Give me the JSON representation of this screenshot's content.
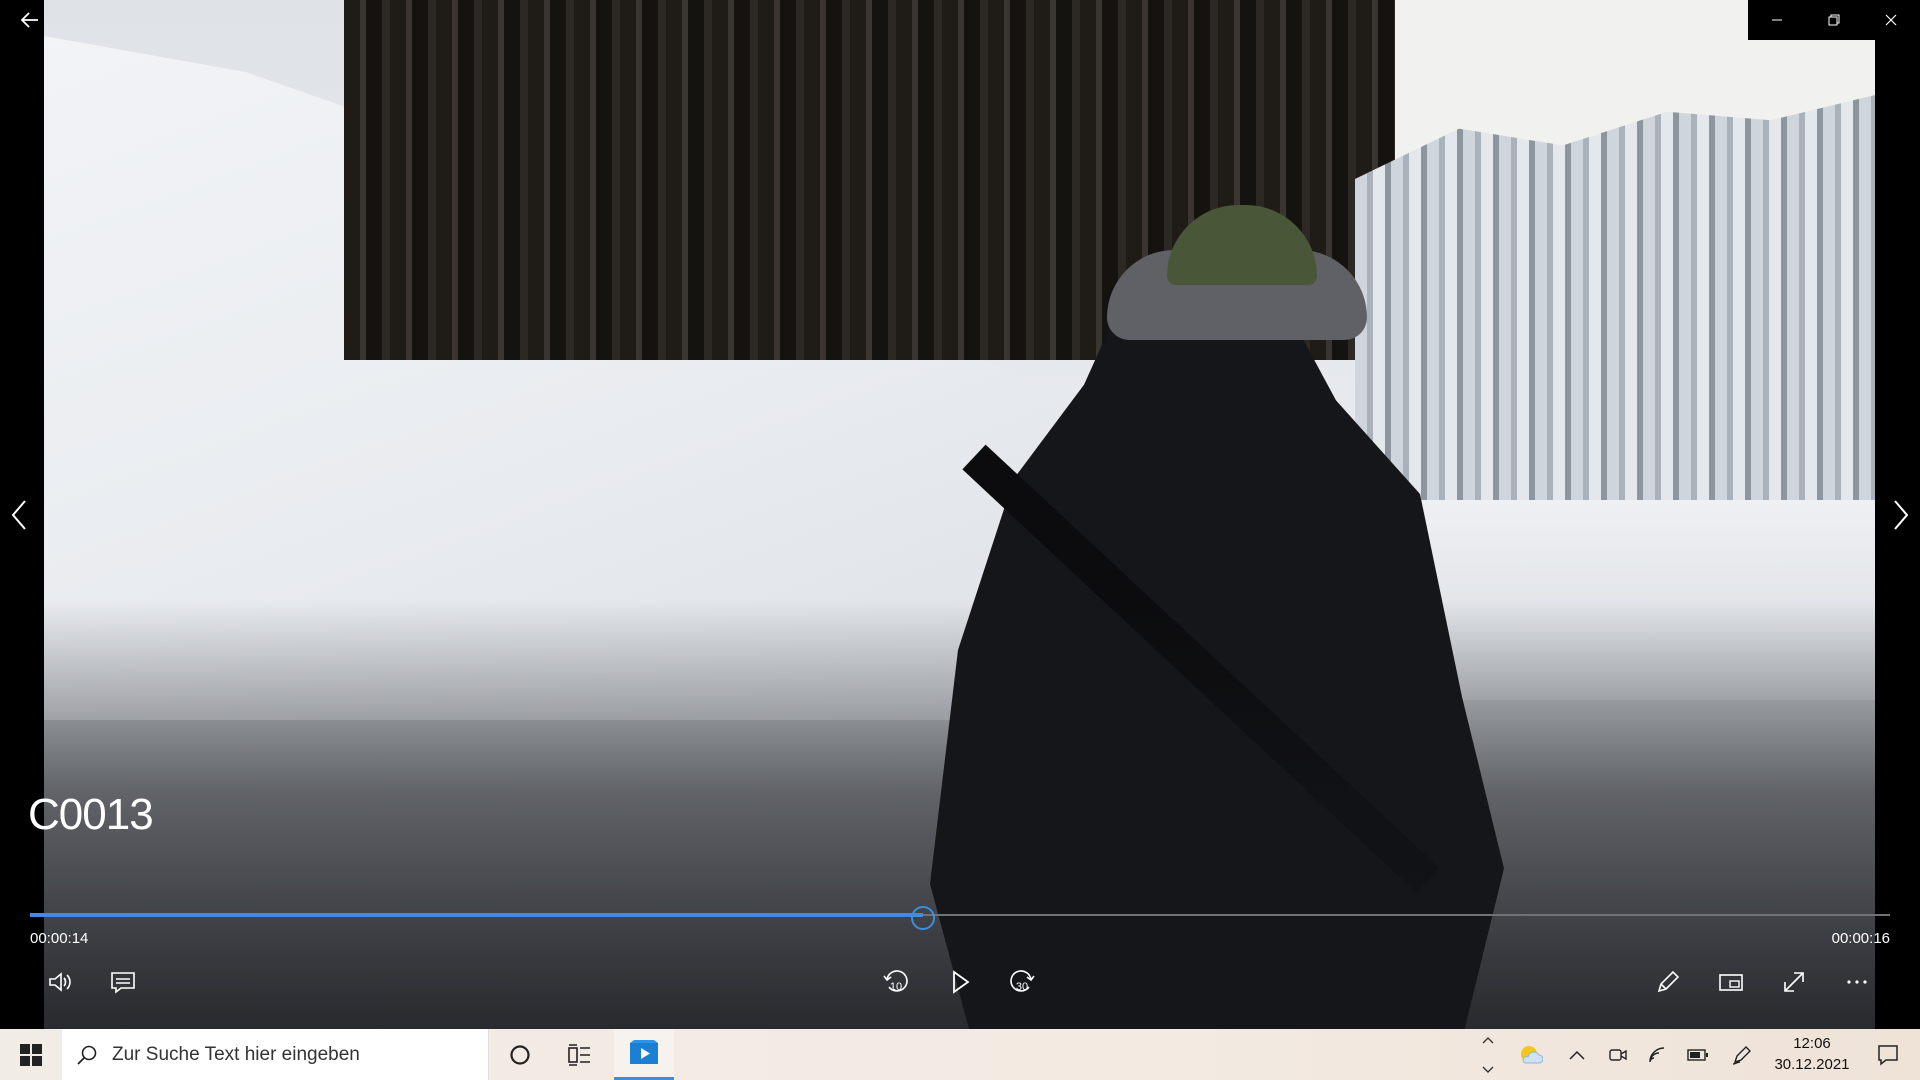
{
  "video": {
    "title": "C0013",
    "current_time": "00:00:14",
    "total_time": "00:00:16",
    "progress_fraction": 0.48
  },
  "controls": {
    "skip_back_label": "10",
    "skip_forward_label": "30"
  },
  "taskbar": {
    "search_placeholder": "Zur Suche Text hier eingeben",
    "time": "12:06",
    "date": "30.12.2021"
  },
  "colors": {
    "accent": "#3d8ee0",
    "taskbar_bg": "#f2ece6"
  },
  "icons": {
    "back": "back-arrow-icon",
    "minimize": "minimize-icon",
    "restore": "restore-icon",
    "close": "close-icon",
    "previous": "chevron-left-icon",
    "next": "chevron-right-icon",
    "volume": "volume-icon",
    "subtitles": "subtitles-icon",
    "skip_back": "skip-back-10-icon",
    "play": "play-icon",
    "skip_forward": "skip-forward-30-icon",
    "edit": "pencil-icon",
    "mini_view": "mini-view-icon",
    "fullscreen": "fullscreen-icon",
    "more": "more-icon"
  }
}
